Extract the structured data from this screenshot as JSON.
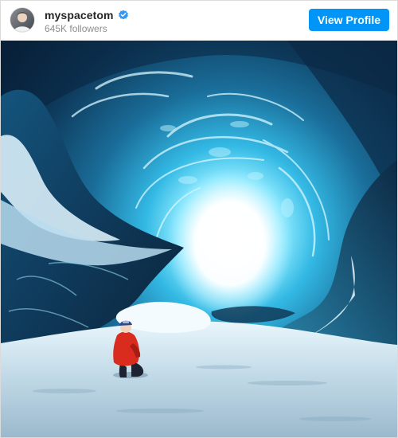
{
  "post": {
    "username": "myspacetom",
    "verified": true,
    "followers": "645K followers",
    "view_profile_label": "View Profile",
    "accent_color": "#0095f6"
  },
  "icons": {
    "verified": "verified-badge-icon",
    "avatar": "profile-photo"
  },
  "photo": {
    "subject": "ice cave photo",
    "palette": {
      "ice_deep": "#0b2440",
      "ice_mid": "#1c6a93",
      "ice_light": "#39c8ea",
      "glow": "#ffffff",
      "snow": "#dcecf5",
      "jacket": "#d92b1e"
    }
  }
}
